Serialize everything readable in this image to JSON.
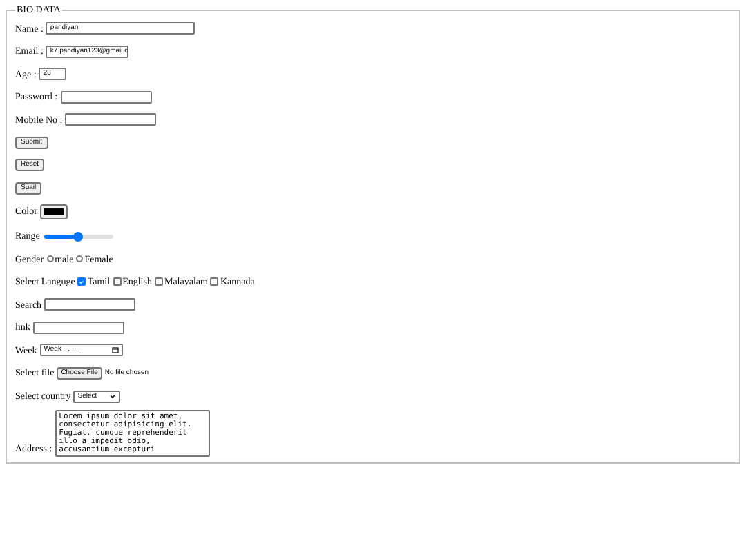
{
  "legend": "BIO DATA",
  "rows": [
    {
      "kind": "text",
      "label": "Name :",
      "value": "pandiyan"
    },
    {
      "kind": "text",
      "label": "Email :",
      "value": "k7.pandiyan123@gmail.c"
    },
    {
      "kind": "text",
      "label": "Age :",
      "value": "28"
    },
    {
      "kind": "text",
      "label": "Password :"
    },
    {
      "kind": "text",
      "label": "Mobile No :"
    },
    {
      "kind": "button",
      "text": "Submit"
    },
    {
      "kind": "button",
      "text": "Reset"
    },
    {
      "kind": "button",
      "text": "Suail"
    },
    {
      "kind": "color",
      "label": "Color",
      "color": "#000000"
    },
    {
      "kind": "range",
      "label": "Range",
      "level": 0.5
    },
    {
      "kind": "radio",
      "label": "Gender",
      "options": [
        {
          "text": "male",
          "selected": false
        },
        {
          "text": "Female",
          "selected": false
        }
      ]
    },
    {
      "kind": "checkbox",
      "label": "Select Languge",
      "options": [
        {
          "text": "Tamil",
          "checked": true
        },
        {
          "text": "English",
          "checked": false
        },
        {
          "text": "Malayalam",
          "checked": false
        },
        {
          "text": "Kannada",
          "checked": false
        }
      ]
    },
    {
      "kind": "text",
      "label": "Search"
    },
    {
      "kind": "text",
      "label": "link"
    },
    {
      "kind": "week",
      "label": "Week",
      "value": "Week --, ----"
    },
    {
      "kind": "file",
      "label": "Select file",
      "button": "Choose File",
      "status": "No file chosen"
    },
    {
      "kind": "select",
      "label": "Select country",
      "value": "Select"
    },
    {
      "kind": "textarea",
      "label": "Address :",
      "value": "Lorem ipsum dolor sit amet,\nconsectetur adipisicing elit.\nFugiat, cumque reprehenderit\nillo a impedit odio,\naccusantium excepturi"
    }
  ]
}
